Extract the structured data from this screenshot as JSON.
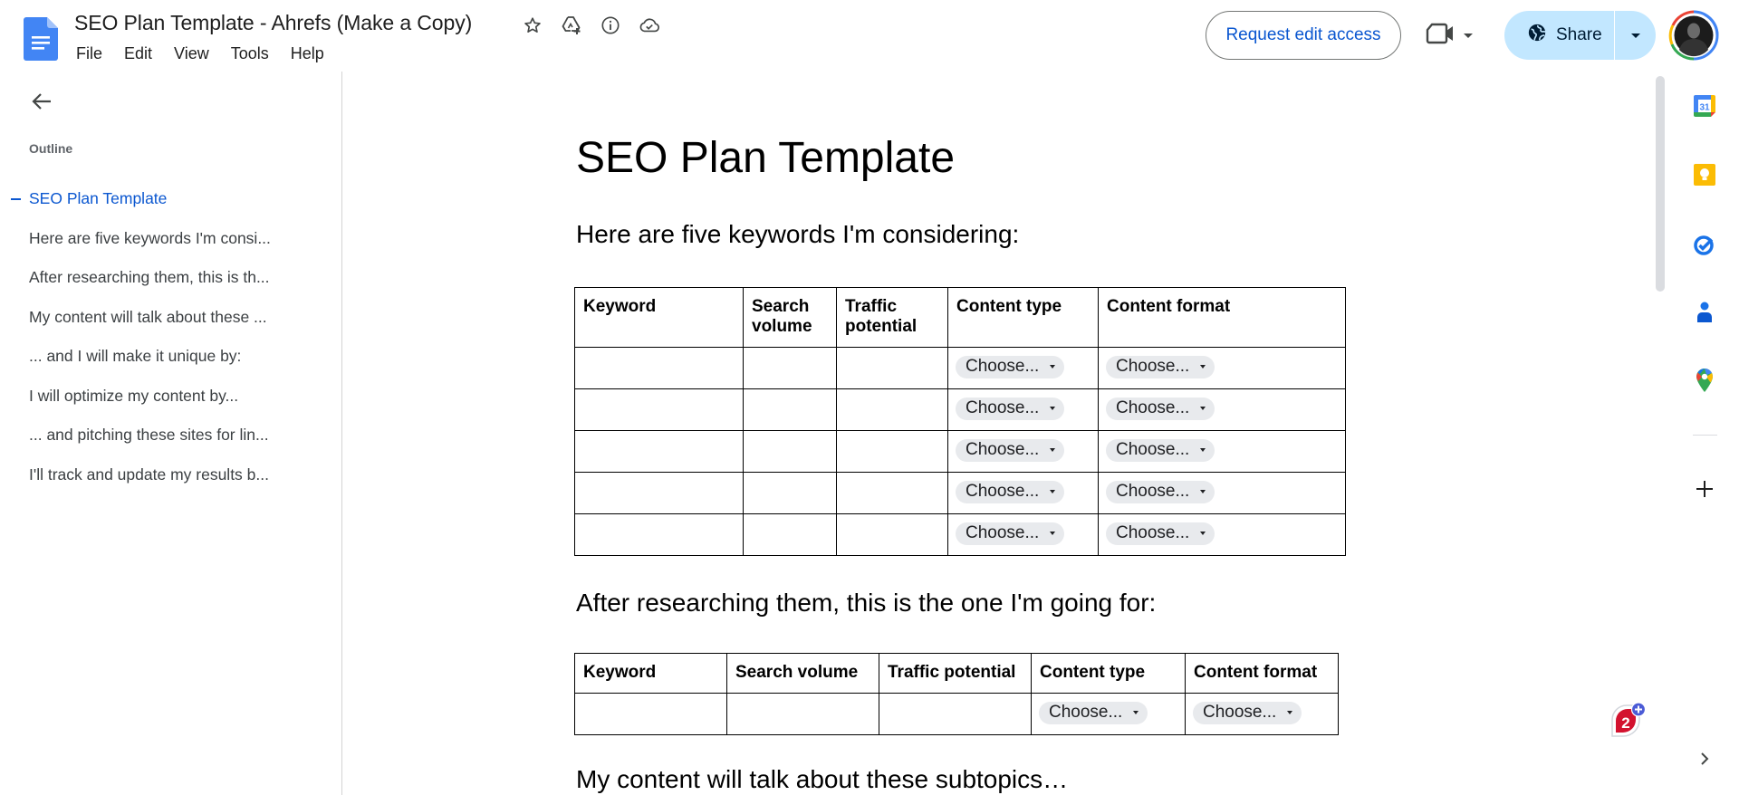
{
  "app": {
    "document_title": "SEO Plan Template - Ahrefs (Make a Copy)",
    "title_icons": [
      "star-icon",
      "move-to-drive-icon",
      "info-icon",
      "cloud-saved-icon"
    ],
    "menu": [
      "File",
      "Edit",
      "View",
      "Tools",
      "Help"
    ],
    "request_edit_label": "Request edit access",
    "share_label": "Share",
    "accent_color": "#0b57d0",
    "share_bg_color": "#c2e7ff"
  },
  "sidebar": {
    "outline_label": "Outline",
    "items": [
      {
        "label": "SEO Plan Template",
        "active": true
      },
      {
        "label": "Here are five keywords I'm consi...",
        "active": false
      },
      {
        "label": "After researching them, this is th...",
        "active": false
      },
      {
        "label": "My content will talk about these ...",
        "active": false
      },
      {
        "label": "... and I will make it unique by:",
        "active": false
      },
      {
        "label": "I will optimize my content by...",
        "active": false
      },
      {
        "label": "... and pitching these sites for lin...",
        "active": false
      },
      {
        "label": "I'll track and update my results b...",
        "active": false
      }
    ]
  },
  "document": {
    "title": "SEO Plan Template",
    "section1_heading": "Here are five keywords I'm considering:",
    "table1": {
      "headers": [
        "Keyword",
        "Search volume",
        "Traffic potential",
        "Content type",
        "Content format"
      ],
      "rows": [
        [
          "",
          "",
          "",
          "Choose...",
          "Choose..."
        ],
        [
          "",
          "",
          "",
          "Choose...",
          "Choose..."
        ],
        [
          "",
          "",
          "",
          "Choose...",
          "Choose..."
        ],
        [
          "",
          "",
          "",
          "Choose...",
          "Choose..."
        ],
        [
          "",
          "",
          "",
          "Choose...",
          "Choose..."
        ]
      ]
    },
    "section2_heading": "After researching them, this is the one I'm going for:",
    "table2": {
      "headers": [
        "Keyword",
        "Search volume",
        "Traffic potential",
        "Content type",
        "Content format"
      ],
      "rows": [
        [
          "",
          "",
          "",
          "Choose...",
          "Choose..."
        ]
      ]
    },
    "section3_heading": "My content will talk about these subtopics…"
  },
  "side_panel": {
    "apps": [
      "calendar-icon",
      "keep-icon",
      "tasks-icon",
      "contacts-icon",
      "maps-icon"
    ],
    "add_label": "+",
    "badge_count": "2"
  }
}
